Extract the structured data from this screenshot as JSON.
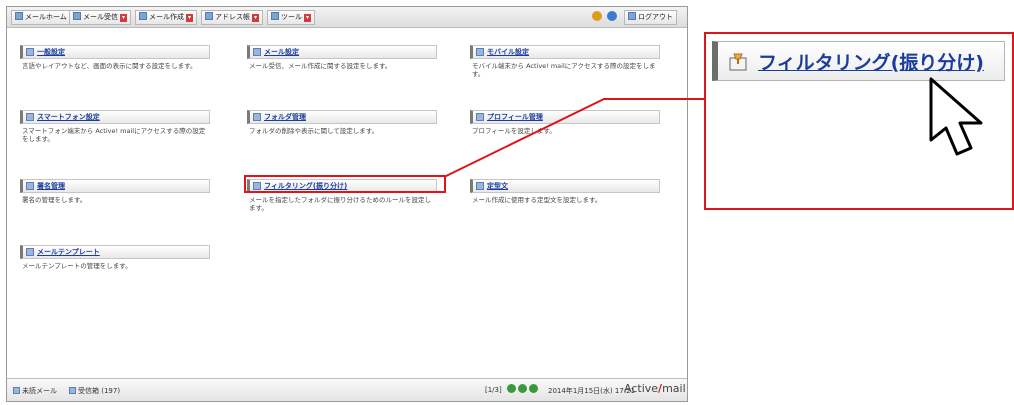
{
  "toolbar": {
    "buttons": [
      "メールホーム",
      "メール受信",
      "メール作成",
      "アドレス帳",
      "ツール"
    ],
    "logout": "ログアウト"
  },
  "items": [
    {
      "title": "一般設定",
      "desc": "言語やレイアウトなど、画面の表示に関する設定をします。"
    },
    {
      "title": "メール設定",
      "desc": "メール受信、メール作成に関する設定をします。"
    },
    {
      "title": "モバイル設定",
      "desc": "モバイル端末から Active! mailにアクセスする際の設定をします。"
    },
    {
      "title": "スマートフォン設定",
      "desc": "スマートフォン端末から Active! mailにアクセスする際の設定をします。"
    },
    {
      "title": "フォルダ管理",
      "desc": "フォルダの削除や表示に関して設定します。"
    },
    {
      "title": "プロフィール管理",
      "desc": "プロフィールを設定します。"
    },
    {
      "title": "署名管理",
      "desc": "署名の管理をします。"
    },
    {
      "title": "フィルタリング(振り分け)",
      "desc": "メールを指定したフォルダに振り分けるためのルールを設定します。"
    },
    {
      "title": "定型文",
      "desc": "メール作成に使用する定型文を設定します。"
    },
    {
      "title": "メールテンプレート",
      "desc": "メールテンプレートの管理をします。"
    }
  ],
  "status": {
    "unread": "未読メール",
    "inbox": "受信箱 (197)",
    "pager": "[1/3]",
    "datetime": "2014年1月15日(水) 17:21",
    "brand_left": "Active",
    "brand_right": "mail"
  },
  "zoom": {
    "title": "フィルタリング(振り分け)"
  },
  "colors": {
    "highlight": "#e0141b",
    "link": "#1a3d9c"
  }
}
